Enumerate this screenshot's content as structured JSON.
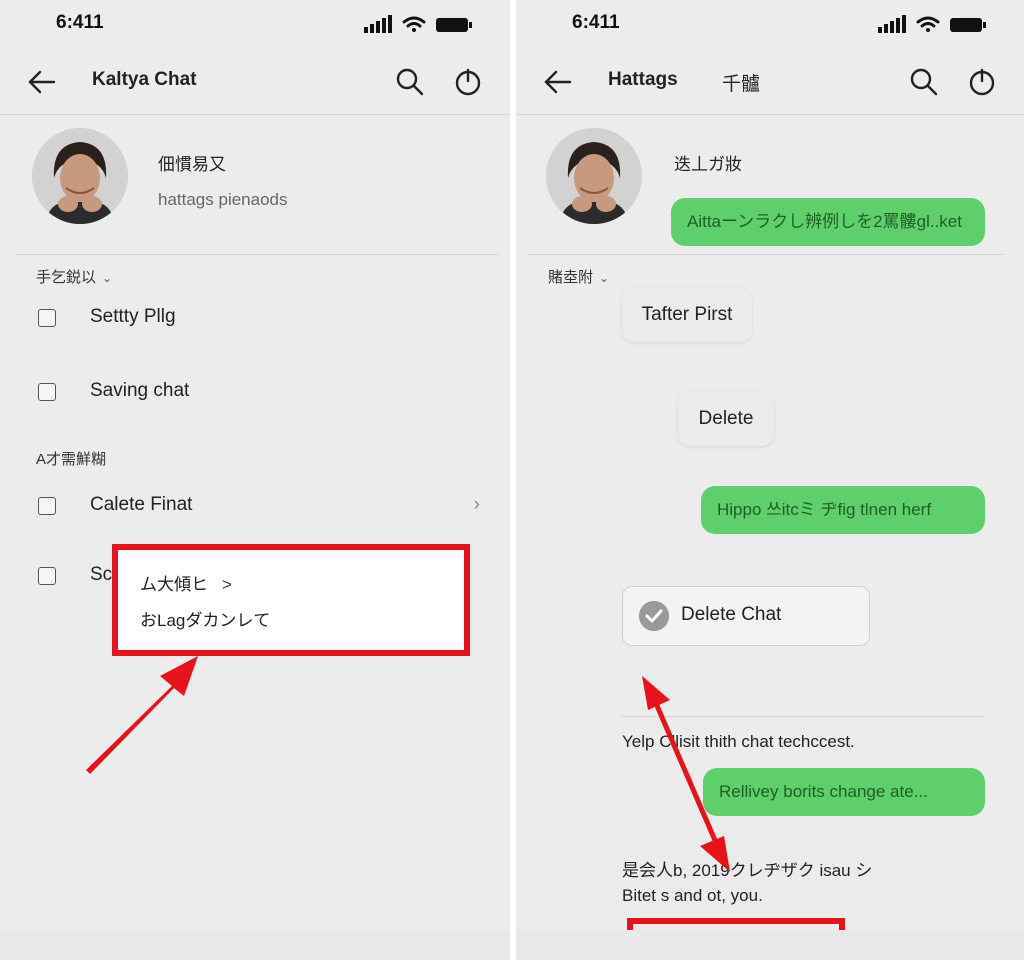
{
  "left_screen": {
    "status": {
      "time": "6:411"
    },
    "appbar": {
      "title": "Kaltya Chat"
    },
    "profile": {
      "name": "佃慣易又",
      "status": "hattags pienaods"
    },
    "section1": {
      "label": "手乞鋭以"
    },
    "items": [
      {
        "label": "Settty Pllg"
      },
      {
        "label": "Saving chat"
      }
    ],
    "section2": {
      "label": "A才需鮮糊"
    },
    "items2": [
      {
        "label": "Calete Finat"
      },
      {
        "label": "Sc"
      }
    ],
    "popup": {
      "line1": "ム大傾ヒ",
      "line1_chevron": ">",
      "line2": "おLagダカンレて"
    }
  },
  "right_screen": {
    "status": {
      "time": "6:411"
    },
    "appbar": {
      "title": "Hattags",
      "subtitle": "千髗"
    },
    "profile": {
      "name": "迭丄ガ妝"
    },
    "bubbles": [
      {
        "text": "Aittaーンラクし辨例しを2罵髏gl..ket"
      },
      {
        "text": "Hippo 쓰itcミ ヂfig tlnen herf"
      },
      {
        "text": "Rellivey borits change ate..."
      }
    ],
    "section": {
      "label": "賭坴附"
    },
    "chips": [
      {
        "label": "Tafter Pirst"
      },
      {
        "label": "Delete"
      }
    ],
    "delete_chat": {
      "label": "Delete Chat"
    },
    "help_text": "Yelp Cllisit thith chat techccest.",
    "note": {
      "line1": "是会人b, 2019クレヂザク isau シ",
      "line2": "Bitet s and ot, you."
    }
  },
  "colors": {
    "accent_red": "#e8121a",
    "bubble_green": "#5fcf6b",
    "bg": "#ececec"
  }
}
